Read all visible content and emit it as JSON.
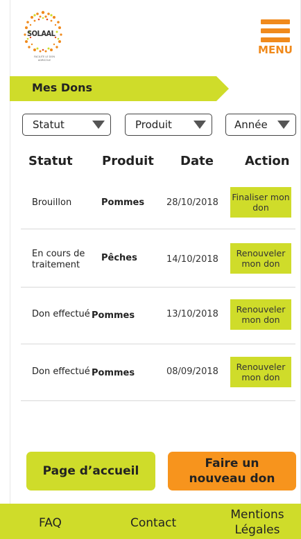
{
  "header": {
    "logo_text": "SOLAAL",
    "logo_tagline": "FACILITE LE DON AGRICOLE",
    "menu_label": "MENU"
  },
  "section_title": "Mes Dons",
  "filters": [
    {
      "label": "Statut"
    },
    {
      "label": "Produit"
    },
    {
      "label": "Année"
    }
  ],
  "table": {
    "headers": [
      "Statut",
      "Produit",
      "Date",
      "Action"
    ],
    "rows": [
      {
        "status": "Brouillon",
        "product": "Pommes",
        "date": "28/10/2018",
        "action": "Finaliser mon don"
      },
      {
        "status": "En cours de traitement",
        "product": "Pêches",
        "date": "14/10/2018",
        "action": "Renouveler mon don"
      },
      {
        "status": "Don effectué",
        "product": "Pommes",
        "date": "13/10/2018",
        "action": "Renouveler mon don"
      },
      {
        "status": "Don effectué",
        "product": "Pommes",
        "date": "08/09/2018",
        "action": "Renouveler mon don"
      }
    ]
  },
  "buttons": {
    "home": "Page d’accueil",
    "new_donation": "Faire un nouveau don"
  },
  "footer": {
    "faq": "FAQ",
    "contact": "Contact",
    "legal": "Mentions Légales"
  },
  "colors": {
    "accent_green": "#cfdc2a",
    "accent_orange": "#f7941d",
    "menu_orange": "#f08a1c"
  }
}
